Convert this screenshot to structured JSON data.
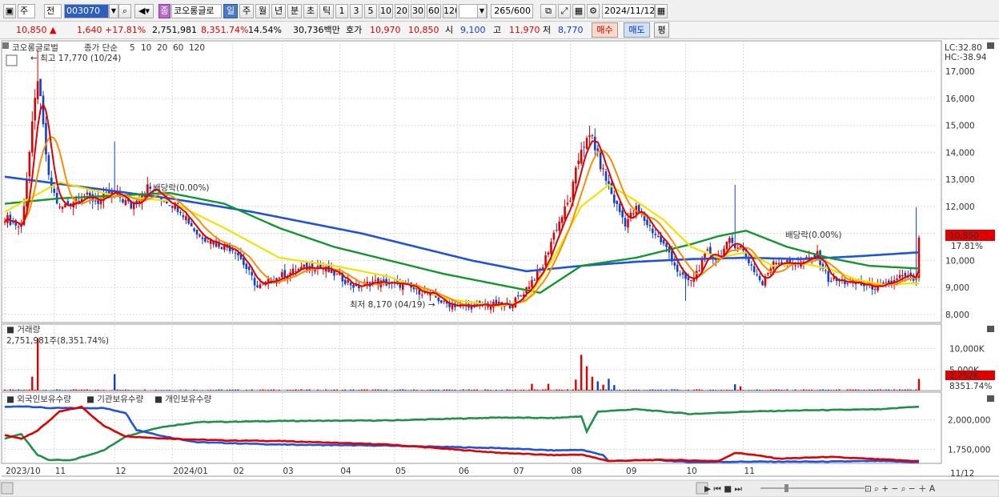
{
  "toolbar": {
    "market_label": "주",
    "market_kind_label": "전",
    "code_value": "003070",
    "stock_name": "코오롱글로",
    "period_buttons": [
      "일",
      "주",
      "월",
      "년",
      "분",
      "초",
      "틱"
    ],
    "minute_buttons": [
      "1",
      "3",
      "5",
      "10",
      "20",
      "30",
      "60",
      "120"
    ],
    "count_value": "265",
    "count_max": "/600",
    "date_value": "2024/11/12",
    "jung_label": "종"
  },
  "quote": {
    "price": "10,850",
    "up_arrow": "▲",
    "change": "1,640",
    "change_pct": "+17.81%",
    "volume": "2,751,981",
    "volume_pct": "8,351.74%",
    "turnover_pct": "14.54%",
    "amount": "30,736백만",
    "hoga_label": "호가",
    "ask": "10,970",
    "bid": "10,850",
    "open_label": "시",
    "open": "9,100",
    "high_label": "고",
    "high": "11,970",
    "low_label": "저",
    "low": "8,770",
    "buy_label": "매수",
    "sell_label": "매도",
    "eval_label": "평"
  },
  "colors": {
    "ma5": "#e00000",
    "ma10": "#ff8c00",
    "ma20": "#f2e200",
    "ma60": "#12962e",
    "ma120": "#2052e0",
    "up": "#e00000",
    "down": "#1040d0",
    "foreign": "#e00000",
    "inst": "#2052e0",
    "indiv": "#20904a"
  },
  "chart_data": [
    {
      "type": "candlestick",
      "title_stock": "코오롱글로벌",
      "legend_prefix": "종가 단순",
      "ma_periods": [
        "5",
        "10",
        "20",
        "60",
        "120"
      ],
      "lc_text": "LC:32.80",
      "hc_text": "HC:-38.94",
      "ylim": [
        7700,
        17600
      ],
      "yticks": [
        "8,000",
        "9,000",
        "10,000",
        "11,000",
        "12,000",
        "13,000",
        "14,000",
        "15,000",
        "16,000",
        "17,000"
      ],
      "current_price_label": "10,850",
      "current_change_label": "17.81%",
      "annotations": {
        "high": "최고 17,770 (10/24)",
        "low": "최저 8,170 (04/19)",
        "div1": "배당락(0.00%)",
        "div2": "배당락(0.00%)"
      },
      "dates": [
        "2023-10-04",
        "2023-11",
        "2023-12",
        "2024-01",
        "2024-02",
        "2024-03",
        "2024-04",
        "2024-05",
        "2024-06",
        "2024-07",
        "2024-08",
        "2024-09",
        "2024-10",
        "2024-11-12"
      ],
      "close_anchors": [
        [
          0,
          11600
        ],
        [
          6,
          11200
        ],
        [
          12,
          16800
        ],
        [
          16,
          13000
        ],
        [
          20,
          11900
        ],
        [
          28,
          12400
        ],
        [
          34,
          12200
        ],
        [
          40,
          12500
        ],
        [
          46,
          12000
        ],
        [
          52,
          12700
        ],
        [
          58,
          12300
        ],
        [
          64,
          11900
        ],
        [
          70,
          11000
        ],
        [
          78,
          10600
        ],
        [
          84,
          10400
        ],
        [
          92,
          9000
        ],
        [
          100,
          9400
        ],
        [
          108,
          9700
        ],
        [
          114,
          9800
        ],
        [
          122,
          9400
        ],
        [
          128,
          9000
        ],
        [
          134,
          9200
        ],
        [
          144,
          9100
        ],
        [
          150,
          8900
        ],
        [
          156,
          8700
        ],
        [
          160,
          8400
        ],
        [
          168,
          8300
        ],
        [
          178,
          8350
        ],
        [
          184,
          8350
        ],
        [
          188,
          8700
        ],
        [
          196,
          9800
        ],
        [
          200,
          11000
        ],
        [
          206,
          12300
        ],
        [
          210,
          14200
        ],
        [
          214,
          14600
        ],
        [
          216,
          13800
        ],
        [
          222,
          12200
        ],
        [
          226,
          11400
        ],
        [
          230,
          11900
        ],
        [
          236,
          11100
        ],
        [
          242,
          10300
        ],
        [
          246,
          9400
        ],
        [
          250,
          9200
        ],
        [
          256,
          10300
        ],
        [
          260,
          10100
        ],
        [
          264,
          10700
        ],
        [
          268,
          10500
        ],
        [
          272,
          9800
        ],
        [
          276,
          9100
        ],
        [
          280,
          10000
        ],
        [
          284,
          9900
        ],
        [
          290,
          9900
        ],
        [
          296,
          10200
        ],
        [
          300,
          9300
        ],
        [
          306,
          9200
        ],
        [
          312,
          9100
        ],
        [
          318,
          9000
        ],
        [
          322,
          9100
        ],
        [
          326,
          9400
        ],
        [
          330,
          9350
        ],
        [
          332,
          9210
        ],
        [
          333,
          10850
        ]
      ],
      "ma20_anchors": [
        [
          0,
          11800
        ],
        [
          20,
          12900
        ],
        [
          40,
          12400
        ],
        [
          60,
          12200
        ],
        [
          80,
          11200
        ],
        [
          100,
          10100
        ],
        [
          120,
          9800
        ],
        [
          140,
          9400
        ],
        [
          160,
          8600
        ],
        [
          180,
          8300
        ],
        [
          190,
          8500
        ],
        [
          200,
          10100
        ],
        [
          210,
          12000
        ],
        [
          220,
          12800
        ],
        [
          230,
          12200
        ],
        [
          240,
          11500
        ],
        [
          250,
          10500
        ],
        [
          260,
          10100
        ],
        [
          270,
          10300
        ],
        [
          280,
          9800
        ],
        [
          290,
          9900
        ],
        [
          300,
          9700
        ],
        [
          310,
          9300
        ],
        [
          320,
          9100
        ],
        [
          330,
          9150
        ]
      ],
      "ma60_anchors": [
        [
          0,
          12100
        ],
        [
          20,
          12300
        ],
        [
          40,
          12400
        ],
        [
          60,
          12500
        ],
        [
          80,
          12100
        ],
        [
          100,
          11200
        ],
        [
          120,
          10500
        ],
        [
          140,
          10000
        ],
        [
          160,
          9500
        ],
        [
          180,
          9100
        ],
        [
          195,
          8800
        ],
        [
          210,
          9800
        ],
        [
          230,
          10100
        ],
        [
          250,
          10600
        ],
        [
          260,
          10900
        ],
        [
          270,
          11100
        ],
        [
          285,
          10500
        ],
        [
          300,
          10100
        ],
        [
          315,
          9800
        ],
        [
          333,
          9700
        ]
      ],
      "ma120_anchors": [
        [
          0,
          13100
        ],
        [
          30,
          12700
        ],
        [
          60,
          12300
        ],
        [
          90,
          11800
        ],
        [
          110,
          11400
        ],
        [
          130,
          11000
        ],
        [
          150,
          10500
        ],
        [
          170,
          10000
        ],
        [
          190,
          9600
        ],
        [
          210,
          9800
        ],
        [
          230,
          9950
        ],
        [
          250,
          10050
        ],
        [
          270,
          10100
        ],
        [
          290,
          10050
        ],
        [
          310,
          10150
        ],
        [
          333,
          10300
        ]
      ],
      "spikes": [
        [
          12,
          17770
        ],
        [
          13,
          15400
        ],
        [
          40,
          14400
        ],
        [
          248,
          8500
        ],
        [
          266,
          12800
        ],
        [
          332,
          11970
        ]
      ]
    },
    {
      "type": "bar",
      "title": "거래량",
      "subtitle": "2,751,981주(8,351.74%)",
      "yticks": [
        "5,000K",
        "10,000K"
      ],
      "ylim": [
        0,
        12000
      ],
      "current_label": "2,752K",
      "current_pct_label": "8351.74%",
      "spikes": [
        [
          10,
          3300
        ],
        [
          12,
          12500
        ],
        [
          40,
          3900
        ],
        [
          192,
          1600
        ],
        [
          198,
          1600
        ],
        [
          208,
          2600
        ],
        [
          210,
          8500
        ],
        [
          212,
          5800
        ],
        [
          214,
          3300
        ],
        [
          216,
          2200
        ],
        [
          218,
          1400
        ],
        [
          220,
          2800
        ],
        [
          222,
          1300
        ],
        [
          266,
          1500
        ],
        [
          268,
          1000
        ],
        [
          333,
          2752
        ]
      ],
      "base_level": 180
    },
    {
      "type": "line",
      "title_series": [
        "외국인보유수량",
        "기관보유수량",
        "개인보유수량"
      ],
      "yticks": [
        "1,750,000",
        "2,000,000"
      ],
      "ylim": [
        1630000,
        2140000
      ],
      "foreign_anchors": [
        [
          0,
          1870000
        ],
        [
          6,
          1840000
        ],
        [
          12,
          1910000
        ],
        [
          20,
          2070000
        ],
        [
          28,
          2110000
        ],
        [
          36,
          1950000
        ],
        [
          44,
          1860000
        ],
        [
          60,
          1840000
        ],
        [
          80,
          1825000
        ],
        [
          100,
          1820000
        ],
        [
          140,
          1790000
        ],
        [
          180,
          1720000
        ],
        [
          200,
          1700000
        ],
        [
          210,
          1705000
        ],
        [
          220,
          1650000
        ],
        [
          240,
          1660000
        ],
        [
          260,
          1650000
        ],
        [
          266,
          1720000
        ],
        [
          272,
          1705000
        ],
        [
          282,
          1670000
        ],
        [
          300,
          1685000
        ],
        [
          318,
          1665000
        ],
        [
          332,
          1650000
        ]
      ],
      "inst_anchors": [
        [
          0,
          2110000
        ],
        [
          8,
          2115000
        ],
        [
          16,
          2100000
        ],
        [
          36,
          2100000
        ],
        [
          44,
          2060000
        ],
        [
          48,
          1915000
        ],
        [
          58,
          1860000
        ],
        [
          70,
          1810000
        ],
        [
          100,
          1790000
        ],
        [
          140,
          1780000
        ],
        [
          180,
          1760000
        ],
        [
          200,
          1740000
        ],
        [
          210,
          1745000
        ],
        [
          218,
          1700000
        ],
        [
          220,
          1650000
        ],
        [
          236,
          1660000
        ],
        [
          250,
          1640000
        ],
        [
          268,
          1645000
        ],
        [
          300,
          1645000
        ],
        [
          318,
          1650000
        ],
        [
          332,
          1640000
        ]
      ],
      "indiv_anchors": [
        [
          0,
          1840000
        ],
        [
          6,
          1880000
        ],
        [
          12,
          1700000
        ],
        [
          16,
          1660000
        ],
        [
          24,
          1655000
        ],
        [
          36,
          1740000
        ],
        [
          44,
          1860000
        ],
        [
          56,
          1935000
        ],
        [
          70,
          1980000
        ],
        [
          100,
          1990000
        ],
        [
          140,
          1995000
        ],
        [
          180,
          2020000
        ],
        [
          200,
          2015000
        ],
        [
          210,
          2030000
        ],
        [
          212,
          1900000
        ],
        [
          216,
          2070000
        ],
        [
          230,
          2090000
        ],
        [
          250,
          2050000
        ],
        [
          270,
          2070000
        ],
        [
          290,
          2080000
        ],
        [
          320,
          2090000
        ],
        [
          330,
          2110000
        ]
      ]
    }
  ],
  "x_labels": [
    "2023/10",
    "11",
    "12",
    "2024/01",
    "02",
    "03",
    "04",
    "05",
    "06",
    "07",
    "08",
    "09",
    "10",
    "11"
  ],
  "x_right_label": "11/12"
}
